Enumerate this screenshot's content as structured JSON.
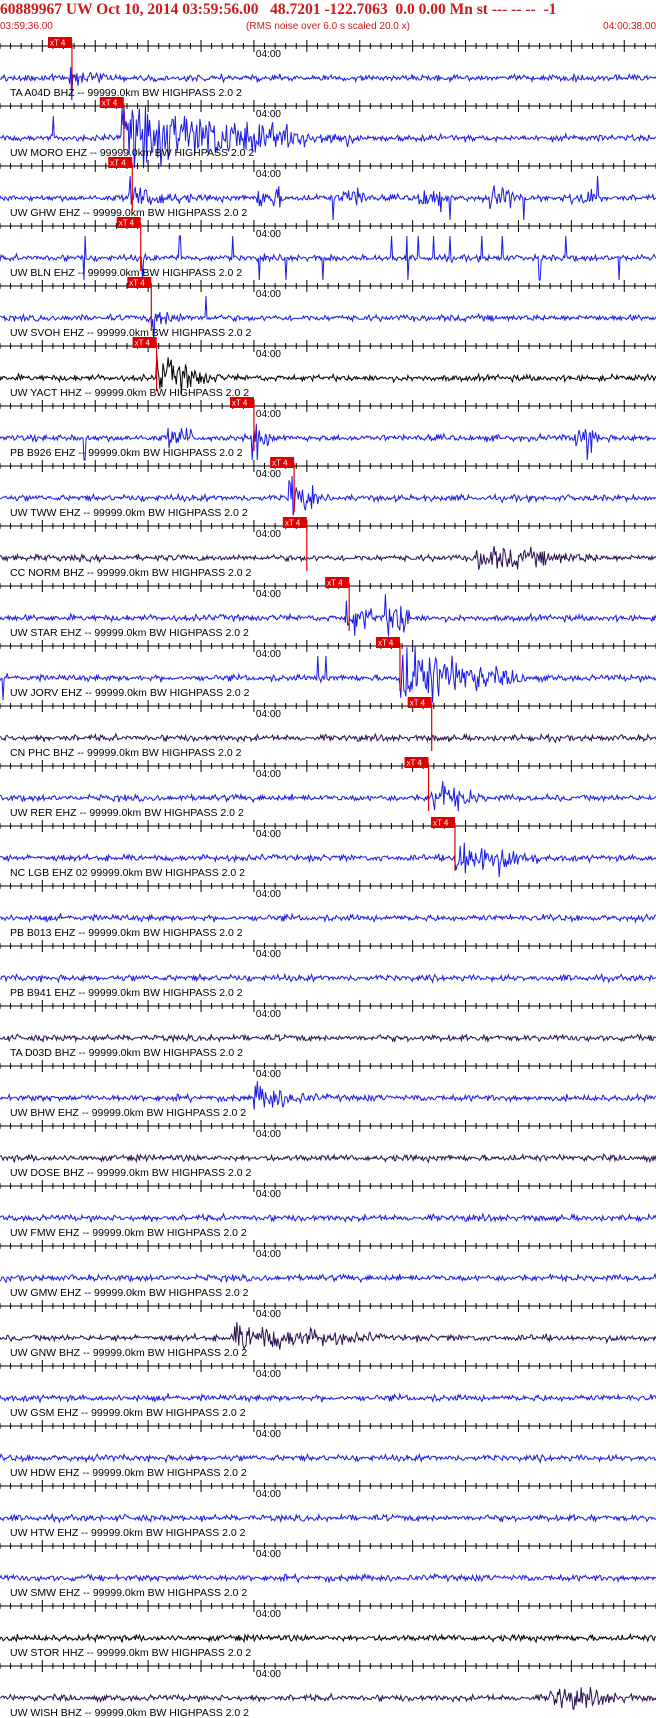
{
  "header": {
    "title": "60889967 UW Oct 10, 2014 03:59:56.00   48.7201 -122.7063  0.0 0.00 Mn st --- -- --  -1",
    "start_time": "03:59:36.00",
    "scaling_note": "(RMS noise over 6.0 s scaled 20.0 x)",
    "end_time": "04:00:38.00"
  },
  "tick_label": "04:00",
  "pick_label": "xT 4",
  "colors": {
    "header_text": "#cc1a1a",
    "pick": "#e00000",
    "blue_trace": "#1a1ae6",
    "black_trace": "#000000",
    "dark_trace": "#2a1050",
    "label": "#000000",
    "axis": "#000000"
  },
  "traces": [
    {
      "label": "TA A04D BHZ -- 99999.0km BW  HIGHPASS  2.0  2",
      "color": "blue",
      "pick_s": 6.8,
      "event": {
        "start": 6.5,
        "amp": 0.4,
        "dur": 3
      },
      "spikes": [
        6.8
      ]
    },
    {
      "label": "UW MORO EHZ -- 99999.0km BW  HIGHPASS  2.0  2",
      "color": "blue",
      "pick_s": 11.7,
      "event": {
        "start": 11.5,
        "amp": 1.3,
        "dur": 22
      },
      "spikes": [
        5.0
      ]
    },
    {
      "label": "UW GHW EHZ -- 99999.0km BW  HIGHPASS  2.0  2",
      "color": "blue",
      "pick_s": 12.5,
      "event": {
        "start": 12.2,
        "amp": 0.45,
        "dur": 6
      },
      "spikes": [
        12.3,
        31.5,
        42.5,
        49.5,
        56.5
      ],
      "bursts": [
        25.5,
        33.5,
        40.5,
        47.5,
        55
      ]
    },
    {
      "label": "UW BLN EHZ -- 99999.0km BW  HIGHPASS  2.0  2",
      "color": "blue",
      "pick_s": 13.3,
      "event": {
        "start": 13.3,
        "amp": 0.05,
        "dur": 1
      },
      "spikes": [
        8.0,
        13.5,
        17.0,
        22.0,
        24.5,
        27.0,
        30.5,
        37.0,
        38.5,
        39.5,
        41.0,
        42.5,
        45.5,
        47.5,
        51.0,
        53.5,
        58.5
      ]
    },
    {
      "label": "UW SVOH EHZ -- 99999.0km BW  HIGHPASS  2.0  2",
      "color": "blue",
      "pick_s": 14.3,
      "event": {
        "start": 14.3,
        "amp": 0.35,
        "dur": 4
      },
      "spikes": [
        14.5,
        19.5
      ]
    },
    {
      "label": "UW YACT HHZ -- 99999.0km BW  HIGHPASS  2.0  2",
      "color": "black",
      "pick_s": 14.8,
      "event": {
        "start": 14.8,
        "amp": 0.8,
        "dur": 6
      },
      "spikes": []
    },
    {
      "label": "PB B926 EHZ -- 99999.0km BW  HIGHPASS  2.0  2",
      "color": "blue",
      "pick_s": 24.0,
      "event": {
        "start": 24.0,
        "amp": 0.5,
        "dur": 2
      },
      "spikes": [
        8.0,
        23.8,
        24.3,
        55.5
      ],
      "bursts": [
        17.0,
        55.5
      ]
    },
    {
      "label": "UW TWW EHZ -- 99999.0km BW  HIGHPASS  2.0  2",
      "color": "blue",
      "pick_s": 27.8,
      "event": {
        "start": 27.3,
        "amp": 1.0,
        "dur": 3
      },
      "spikes": [
        27.6
      ]
    },
    {
      "label": "CC NORM BHZ -- 99999.0km BW  HIGHPASS  2.0  2",
      "color": "dark",
      "pick_s": 29.0,
      "event": {
        "start": 45.0,
        "amp": 0.45,
        "dur": 12
      },
      "spikes": []
    },
    {
      "label": "UW STAR EHZ -- 99999.0km BW  HIGHPASS  2.0  2",
      "color": "blue",
      "pick_s": 33.0,
      "event": {
        "start": 32.6,
        "amp": 0.7,
        "dur": 4
      },
      "spikes": [],
      "bursts": [
        37.5,
        37.5
      ]
    },
    {
      "label": "UW JORV EHZ -- 99999.0km BW  HIGHPASS  2.0  2",
      "color": "blue",
      "pick_s": 37.8,
      "event": {
        "start": 37.7,
        "amp": 1.3,
        "dur": 12
      },
      "spikes": [
        0.3,
        30.0,
        30.8
      ]
    },
    {
      "label": "CN PHC BHZ -- 99999.0km BW  HIGHPASS  2.0  2",
      "color": "dark",
      "pick_s": 40.8,
      "event": {
        "start": 40.8,
        "amp": 0.05,
        "dur": 1
      },
      "spikes": []
    },
    {
      "label": "UW RER EHZ -- 99999.0km BW  HIGHPASS  2.0  2",
      "color": "blue",
      "pick_s": 40.5,
      "event": {
        "start": 40.7,
        "amp": 0.7,
        "dur": 5
      },
      "spikes": []
    },
    {
      "label": "NC LGB EHZ 02 99999.0km BW  HIGHPASS  2.0  2",
      "color": "blue",
      "pick_s": 43.0,
      "event": {
        "start": 43.0,
        "amp": 0.9,
        "dur": 8
      },
      "spikes": []
    },
    {
      "label": "PB B013 EHZ -- 99999.0km BW  HIGHPASS  2.0  2",
      "color": "blue",
      "pick_s": null,
      "event": null,
      "spikes": []
    },
    {
      "label": "PB B941 EHZ -- 99999.0km BW  HIGHPASS  2.0  2",
      "color": "blue",
      "pick_s": null,
      "event": null,
      "spikes": []
    },
    {
      "label": "TA D03D BHZ -- 99999.0km BW  HIGHPASS  2.0  2",
      "color": "dark",
      "pick_s": null,
      "event": null,
      "spikes": []
    },
    {
      "label": "UW BHW EHZ -- 99999.0km BW  HIGHPASS  2.0  2",
      "color": "blue",
      "pick_s": null,
      "event": {
        "start": 24.0,
        "amp": 0.5,
        "dur": 6
      },
      "spikes": []
    },
    {
      "label": "UW DOSE BHZ -- 99999.0km BW  HIGHPASS  2.0  2",
      "color": "dark",
      "pick_s": null,
      "event": null,
      "spikes": []
    },
    {
      "label": "UW FMW EHZ -- 99999.0km BW  HIGHPASS  2.0  2",
      "color": "blue",
      "pick_s": null,
      "event": null,
      "spikes": []
    },
    {
      "label": "UW GMW EHZ -- 99999.0km BW  HIGHPASS  2.0  2",
      "color": "blue",
      "pick_s": null,
      "event": null,
      "spikes": []
    },
    {
      "label": "UW GNW BHZ -- 99999.0km BW  HIGHPASS  2.0  2",
      "color": "dark",
      "pick_s": null,
      "event": {
        "start": 22.0,
        "amp": 0.55,
        "dur": 14
      },
      "spikes": []
    },
    {
      "label": "UW GSM EHZ -- 99999.0km BW  HIGHPASS  2.0  2",
      "color": "blue",
      "pick_s": null,
      "event": null,
      "spikes": []
    },
    {
      "label": "UW HDW EHZ -- 99999.0km BW  HIGHPASS  2.0  2",
      "color": "blue",
      "pick_s": null,
      "event": null,
      "spikes": []
    },
    {
      "label": "UW HTW EHZ -- 99999.0km BW  HIGHPASS  2.0  2",
      "color": "blue",
      "pick_s": null,
      "event": null,
      "spikes": []
    },
    {
      "label": "UW SMW EHZ -- 99999.0km BW  HIGHPASS  2.0  2",
      "color": "blue",
      "pick_s": null,
      "event": null,
      "spikes": []
    },
    {
      "label": "UW STOR HHZ -- 99999.0km BW  HIGHPASS  2.0  2",
      "color": "black",
      "pick_s": null,
      "event": null,
      "spikes": []
    },
    {
      "label": "UW WISH BHZ -- 99999.0km BW  HIGHPASS  2.0  2",
      "color": "dark",
      "pick_s": null,
      "event": {
        "start": 52.0,
        "amp": 0.45,
        "dur": 8
      },
      "spikes": []
    }
  ]
}
